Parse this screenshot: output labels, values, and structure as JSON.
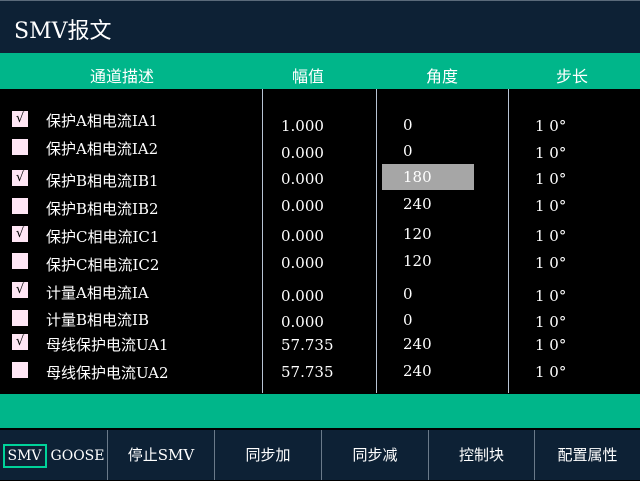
{
  "title": "SMV报文",
  "headers": {
    "desc": "通道描述",
    "amp": "幅值",
    "angle": "角度",
    "step": "步长"
  },
  "rows": [
    {
      "checked": true,
      "desc": "保护A相电流IA1",
      "amp": "1.000",
      "angle": "0",
      "step": "1 0°"
    },
    {
      "checked": false,
      "desc": "保护A相电流IA2",
      "amp": "0.000",
      "angle": "0",
      "step": "1 0°"
    },
    {
      "checked": true,
      "desc": "保护B相电流IB1",
      "amp": "0.000",
      "angle": "180",
      "step": "1 0°"
    },
    {
      "checked": false,
      "desc": "保护B相电流IB2",
      "amp": "0.000",
      "angle": "240",
      "step": "1 0°"
    },
    {
      "checked": true,
      "desc": "保护C相电流IC1",
      "amp": "0.000",
      "angle": "120",
      "step": "1 0°"
    },
    {
      "checked": false,
      "desc": "保护C相电流IC2",
      "amp": "0.000",
      "angle": "120",
      "step": "1 0°"
    },
    {
      "checked": true,
      "desc": "计量A相电流IA",
      "amp": "0.000",
      "angle": "0",
      "step": "1 0°"
    },
    {
      "checked": false,
      "desc": "计量B相电流IB",
      "amp": "0.000",
      "angle": "0",
      "step": "1 0°"
    },
    {
      "checked": true,
      "desc": "母线保护电流UA1",
      "amp": "57.735",
      "angle": "240",
      "step": "1 0°"
    },
    {
      "checked": false,
      "desc": "母线保护电流UA2",
      "amp": "57.735",
      "angle": "240",
      "step": "1 0°"
    }
  ],
  "check_mark": "√",
  "buttons": {
    "smv": "SMV",
    "goose": "GOOSE",
    "stop": "停止SMV",
    "sync_add": "同步加",
    "sync_sub": "同步减",
    "control_block": "控制块",
    "config": "配置属性"
  },
  "colors": {
    "accent": "#00b68a",
    "bar": "#0d2135",
    "selection": "#a6a6a6",
    "checkbox": "#ffe6f5"
  }
}
